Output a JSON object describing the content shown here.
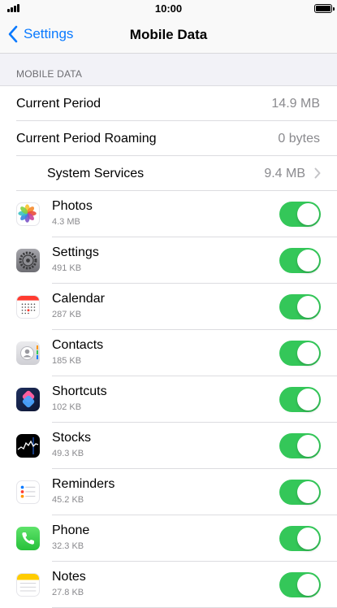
{
  "status_bar": {
    "time": "10:00"
  },
  "nav": {
    "back_label": "Settings",
    "title": "Mobile Data"
  },
  "section": {
    "header": "MOBILE DATA"
  },
  "summary": [
    {
      "label": "Current Period",
      "value": "14.9 MB"
    },
    {
      "label": "Current Period Roaming",
      "value": "0 bytes"
    },
    {
      "label": "System Services",
      "value": "9.4 MB"
    }
  ],
  "apps": [
    {
      "name": "Photos",
      "usage": "4.3 MB",
      "icon": "photos-icon",
      "enabled": true
    },
    {
      "name": "Settings",
      "usage": "491 KB",
      "icon": "settings-icon",
      "enabled": true
    },
    {
      "name": "Calendar",
      "usage": "287 KB",
      "icon": "calendar-icon",
      "enabled": true
    },
    {
      "name": "Contacts",
      "usage": "185 KB",
      "icon": "contacts-icon",
      "enabled": true
    },
    {
      "name": "Shortcuts",
      "usage": "102 KB",
      "icon": "shortcuts-icon",
      "enabled": true
    },
    {
      "name": "Stocks",
      "usage": "49.3 KB",
      "icon": "stocks-icon",
      "enabled": true
    },
    {
      "name": "Reminders",
      "usage": "45.2 KB",
      "icon": "reminders-icon",
      "enabled": true
    },
    {
      "name": "Phone",
      "usage": "32.3 KB",
      "icon": "phone-icon",
      "enabled": true
    },
    {
      "name": "Notes",
      "usage": "27.8 KB",
      "icon": "notes-icon",
      "enabled": true
    }
  ],
  "colors": {
    "accent": "#0a7aff",
    "toggle_on": "#34c759",
    "background": "#f2f2f7",
    "secondary_text": "#8a8a8e"
  }
}
